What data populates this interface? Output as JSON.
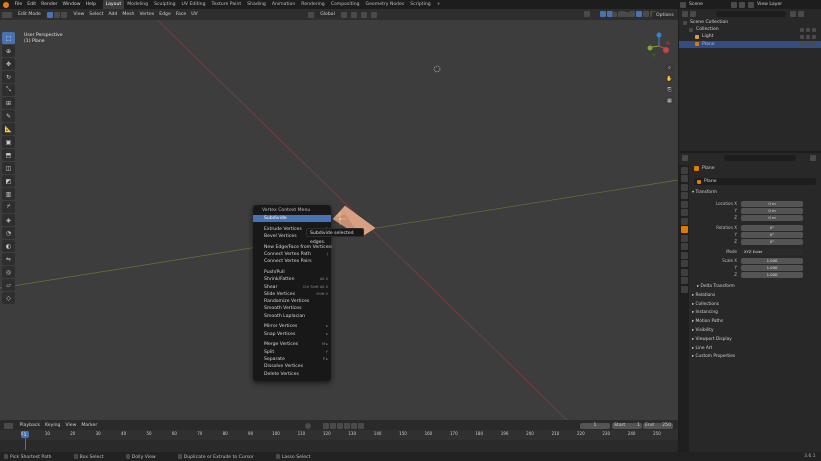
{
  "topbar": {
    "menus": [
      "File",
      "Edit",
      "Render",
      "Window",
      "Help"
    ],
    "workspaces": [
      "Layout",
      "Modeling",
      "Sculpting",
      "UV Editing",
      "Texture Paint",
      "Shading",
      "Animation",
      "Rendering",
      "Compositing",
      "Geometry Nodes",
      "Scripting"
    ],
    "scene": "Scene",
    "view_layer": "View Layer"
  },
  "viewport": {
    "mode": "Edit Mode",
    "menus": [
      "View",
      "Select",
      "Add",
      "Mesh",
      "Vertex",
      "Edge",
      "Face",
      "UV"
    ],
    "transform_orientation": "Global",
    "options_label": "Options",
    "info_line1": "User Perspective",
    "info_line2": "(1) Plane"
  },
  "gizmo": {
    "x": "X",
    "y": "Y",
    "z": "Z"
  },
  "context_menu": {
    "title": "Vertex Context Menu",
    "groups": [
      [
        {
          "label": "Subdivide",
          "shortcut": "",
          "active": true
        }
      ],
      [
        {
          "label": "Extrude Vertices",
          "shortcut": "E"
        },
        {
          "label": "Bevel Vertices",
          "shortcut": "Ctrl Shift B"
        }
      ],
      [
        {
          "label": "New Edge/Face from Vertices",
          "shortcut": "F"
        },
        {
          "label": "Connect Vertex Path",
          "shortcut": "J"
        },
        {
          "label": "Connect Vertex Pairs",
          "shortcut": ""
        }
      ],
      [
        {
          "label": "Push/Pull",
          "shortcut": ""
        },
        {
          "label": "Shrink/Fatten",
          "shortcut": "Alt S"
        },
        {
          "label": "Shear",
          "shortcut": "Ctrl Shift Alt S"
        },
        {
          "label": "Slide Vertices",
          "shortcut": "Shift V"
        },
        {
          "label": "Randomize Vertices",
          "shortcut": ""
        },
        {
          "label": "Smooth Vertices",
          "shortcut": ""
        },
        {
          "label": "Smooth Laplacian",
          "shortcut": ""
        }
      ],
      [
        {
          "label": "Mirror Vertices",
          "shortcut": "▸"
        },
        {
          "label": "Snap Vertices",
          "shortcut": "▸"
        }
      ],
      [
        {
          "label": "Merge Vertices",
          "shortcut": "M ▸"
        },
        {
          "label": "Split",
          "shortcut": "Y"
        },
        {
          "label": "Separate",
          "shortcut": "P ▸"
        },
        {
          "label": "Dissolve Vertices",
          "shortcut": ""
        },
        {
          "label": "Delete Vertices",
          "shortcut": ""
        }
      ]
    ],
    "tooltip": "Subdivide selected edges."
  },
  "timeline": {
    "menus": [
      "Playback",
      "Keying",
      "View",
      "Marker"
    ],
    "current_frame": "1",
    "start_label": "Start",
    "start": "1",
    "end_label": "End",
    "end": "250",
    "ticks": [
      "0",
      "10",
      "20",
      "30",
      "40",
      "50",
      "60",
      "70",
      "80",
      "90",
      "100",
      "110",
      "120",
      "130",
      "140",
      "150",
      "160",
      "170",
      "180",
      "190",
      "200",
      "210",
      "220",
      "230",
      "240",
      "250"
    ]
  },
  "statusbar": {
    "items": [
      "Pick Shortest Path",
      "Box Select",
      "Dolly View",
      "Duplicate or Extrude to Cursor",
      "Lasso Select"
    ],
    "version": "3.6.1"
  },
  "outliner": {
    "rows": [
      {
        "label": "Scene Collection",
        "indent": 0
      },
      {
        "label": "Collection",
        "indent": 1
      },
      {
        "label": "Light",
        "indent": 2
      },
      {
        "label": "Plane",
        "indent": 2,
        "selected": true
      }
    ]
  },
  "properties": {
    "object_name": "Plane",
    "data_name": "Plane",
    "transform_title": "Transform",
    "location_label": "Location X",
    "location": [
      "0 m",
      "0 m",
      "0 m"
    ],
    "rotation_label": "Rotation X",
    "rotation": [
      "0°",
      "0°",
      "0°"
    ],
    "mode_label": "Mode",
    "mode": "XYZ Euler",
    "scale_label": "Scale X",
    "scale": [
      "1.000",
      "1.000",
      "1.000"
    ],
    "axis_y": "Y",
    "axis_z": "Z",
    "sections": [
      "Delta Transform",
      "Relations",
      "Collections",
      "Instancing",
      "Motion Paths",
      "Visibility",
      "Viewport Display",
      "Line Art",
      "Custom Properties"
    ]
  },
  "colors": {
    "accent": "#4772b3",
    "x_axis": "#c9414a",
    "y_axis": "#7fa535",
    "z_axis": "#3c82c8",
    "mesh": "#e8a37a"
  }
}
